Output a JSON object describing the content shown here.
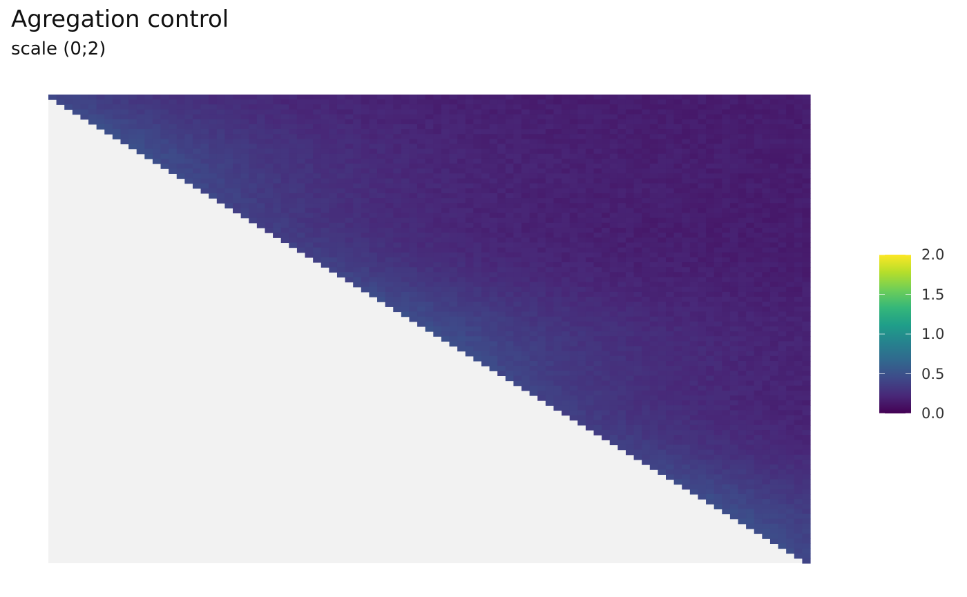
{
  "chart_data": {
    "type": "heatmap",
    "title": "Agregation control",
    "subtitle": "scale (0;2)",
    "matrix_shape": "upper-triangular",
    "n_rows": 95,
    "n_cols": 95,
    "value_range": [
      0,
      2
    ],
    "typical_values": {
      "low": 0.15,
      "high": 0.45
    },
    "colormap": "viridis",
    "missing_color": "#f2f2f2",
    "colorbar": {
      "ticks": [
        {
          "value": 0.0,
          "label": "0.0"
        },
        {
          "value": 0.5,
          "label": "0.5"
        },
        {
          "value": 1.0,
          "label": "1.0"
        },
        {
          "value": 1.5,
          "label": "1.5"
        },
        {
          "value": 2.0,
          "label": "2.0"
        }
      ]
    },
    "colors": {
      "viridis_stops": [
        "#440154",
        "#482878",
        "#3e4a89",
        "#31688e",
        "#26828e",
        "#1f9e89",
        "#35b779",
        "#6ece58",
        "#b5de2b",
        "#fde725"
      ]
    }
  }
}
